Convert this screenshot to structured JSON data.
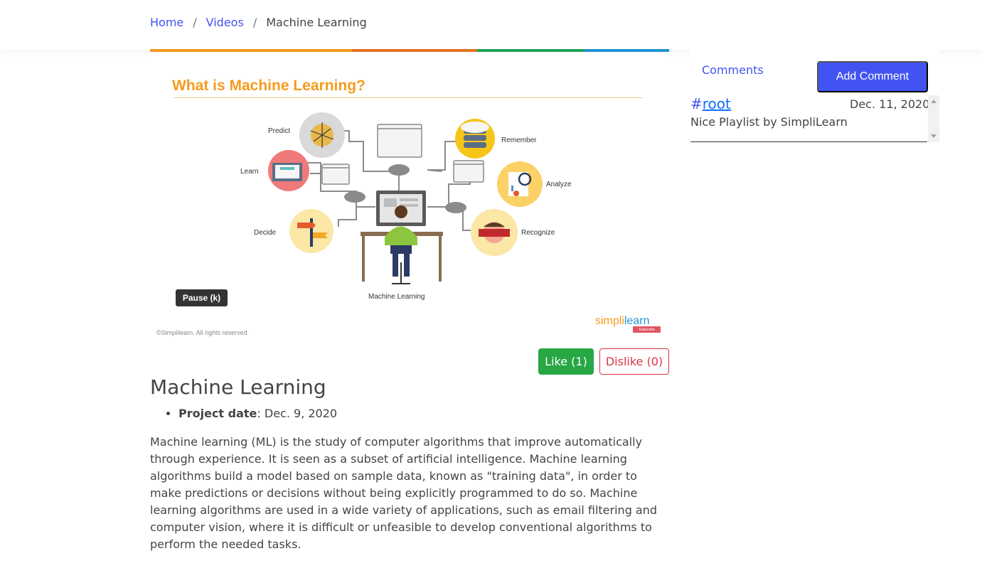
{
  "breadcrumb": {
    "home": "Home",
    "videos": "Videos",
    "separator": "/",
    "current": "Machine Learning"
  },
  "video": {
    "title": "What is Machine Learning?",
    "labels": {
      "predict": "Predict",
      "learn": "Learn",
      "decide": "Decide",
      "remember": "Remember",
      "analyze": "Analyze",
      "recognize": "Recognize",
      "center": "Machine Learning"
    },
    "pause_button": "Pause (k)",
    "copyright": "©Simplilearn. All rights reserved.",
    "logo_part1": "simpli",
    "logo_part2": "learn",
    "subscribe": "Subscribe",
    "colorbar": [
      "#f59b1e",
      "#e3731d",
      "#22a05b",
      "#1f93d2"
    ]
  },
  "actions": {
    "like": "Like (1)",
    "dislike": "Dislike (0)"
  },
  "post": {
    "title": "Machine Learning",
    "project_date_label": "Project date",
    "project_date_value": ": Dec. 9, 2020",
    "description": "Machine learning (ML) is the study of computer algorithms that improve automatically through experience. It is seen as a subset of artificial intelligence. Machine learning algorithms build a model based on sample data, known as \"training data\", in order to make predictions or decisions without being explicitly programmed to do so. Machine learning algorithms are used in a wide variety of applications, such as email filtering and computer vision, where it is difficult or unfeasible to develop conventional algorithms to perform the needed tasks."
  },
  "comments": {
    "label": "Comments",
    "add_button": "Add Comment",
    "items": [
      {
        "hash": "#",
        "author": "root",
        "date": "Dec. 11, 2020",
        "text": "Nice Playlist by SimpliLearn"
      }
    ]
  },
  "colors": {
    "primary": "#4154f1",
    "like": "#28a745",
    "dislike": "#dc3545",
    "text": "#444444",
    "accent_orange": "#f59b1e"
  }
}
